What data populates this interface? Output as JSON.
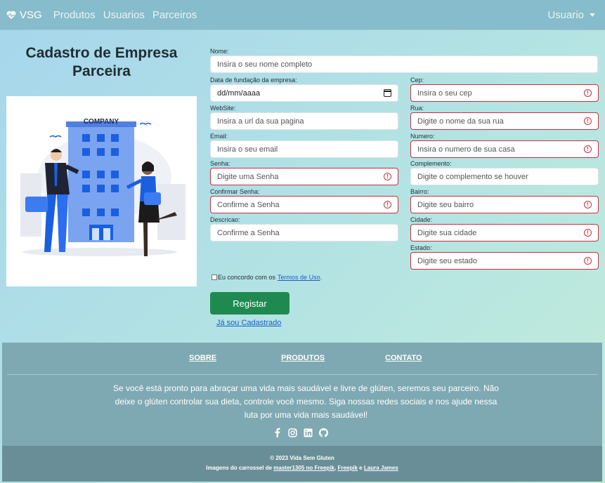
{
  "nav": {
    "brand": "VSG",
    "links": [
      "Produtos",
      "Usuarios",
      "Parceiros"
    ],
    "user": "Usuario"
  },
  "page_title": "Cadastro de Empresa Parceira",
  "illustration": {
    "building_sign": "COMPANY"
  },
  "form": {
    "nome": {
      "label": "Nome:",
      "placeholder": "Insira o seu nome completo"
    },
    "data_fundacao": {
      "label": "Data de fundação da empresa:",
      "value": "dd/mm/aaaa"
    },
    "website": {
      "label": "WebSite:",
      "placeholder": "Insira a url da sua pagina"
    },
    "email": {
      "label": "Email:",
      "placeholder": "Insira o seu email"
    },
    "senha": {
      "label": "Senha:",
      "placeholder": "Digite uma Senha"
    },
    "confirmar_senha": {
      "label": "Confirmar Senha:",
      "placeholder": "Confirme a Senha"
    },
    "descricao": {
      "label": "Descricao:",
      "placeholder": "Confirme a Senha"
    },
    "cep": {
      "label": "Cep:",
      "placeholder": "Insira o seu cep"
    },
    "rua": {
      "label": "Rua:",
      "placeholder": "Digite o nome da sua rua"
    },
    "numero": {
      "label": "Numero:",
      "placeholder": "Insira o numero de sua casa"
    },
    "complemento": {
      "label": "Complemento:",
      "placeholder": "Digite o complemento se houver"
    },
    "bairro": {
      "label": "Bairro:",
      "placeholder": "Digite seu bairro"
    },
    "cidade": {
      "label": "Cidade:",
      "placeholder": "Digite sua cidade"
    },
    "estado": {
      "label": "Estado:",
      "placeholder": "Digite seu estado"
    },
    "terms_prefix": "Eu concordo com os",
    "terms_link": "Termos de Uso",
    "terms_suffix": ".",
    "register_button": "Registar",
    "login_link": "Já sou Cadastrado"
  },
  "footer": {
    "links": [
      "SOBRE",
      "PRODUTOS",
      "CONTATO"
    ],
    "text": "Se você está pronto para abraçar uma vida mais saudável e livre de glúten, seremos seu parceiro. Não deixe o glúten controlar sua dieta, controle você mesmo. Siga nossas redes sociais e nos ajude nessa luta por uma vida mais saudável!",
    "social": [
      "facebook-icon",
      "instagram-icon",
      "linkedin-icon",
      "github-icon"
    ],
    "copyright": "© 2023 Vida Sem Gluten",
    "credits_prefix": "Imagens do carrossel de",
    "credit_1": "master1305 no Freepik",
    "credit_sep": ",",
    "credit_2": "Freepik",
    "credit_and": "e",
    "credit_3": "Laura James"
  },
  "colors": {
    "invalid_border": "#c9303e",
    "register_button": "#1f8a50",
    "link": "#1a5ec7",
    "navbar": "#86bccb",
    "footer": "#7fa9b2"
  }
}
